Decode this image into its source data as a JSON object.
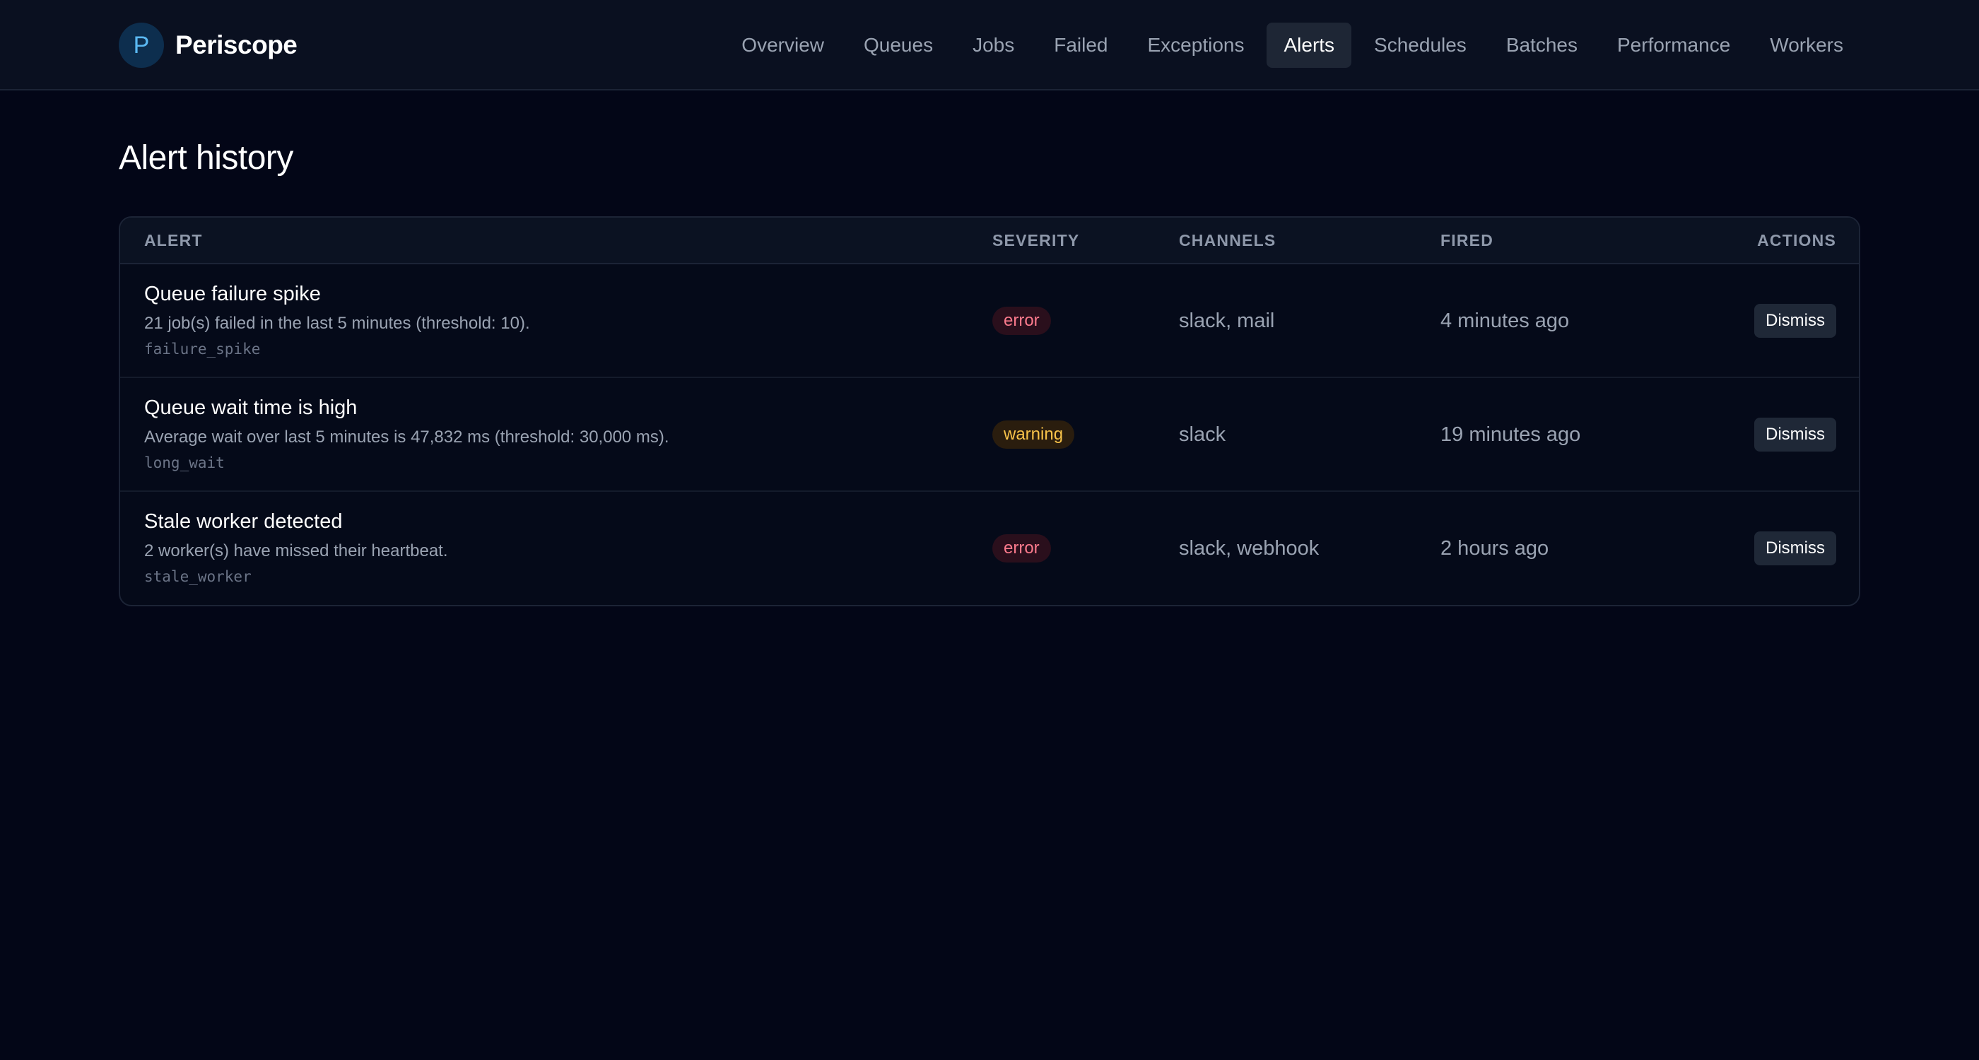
{
  "app": {
    "logo_letter": "P",
    "name": "Periscope"
  },
  "nav": {
    "items": [
      {
        "label": "Overview"
      },
      {
        "label": "Queues"
      },
      {
        "label": "Jobs"
      },
      {
        "label": "Failed"
      },
      {
        "label": "Exceptions"
      },
      {
        "label": "Alerts",
        "active": true
      },
      {
        "label": "Schedules"
      },
      {
        "label": "Batches"
      },
      {
        "label": "Performance"
      },
      {
        "label": "Workers"
      }
    ]
  },
  "page": {
    "title": "Alert history"
  },
  "table": {
    "headers": {
      "alert": "Alert",
      "severity": "Severity",
      "channels": "Channels",
      "fired": "Fired",
      "actions": "Actions"
    },
    "rows": [
      {
        "title": "Queue failure spike",
        "description": "21 job(s) failed in the last 5 minutes (threshold: 10).",
        "key": "failure_spike",
        "severity": "error",
        "channels": "slack, mail",
        "fired": "4 minutes ago",
        "action": "Dismiss"
      },
      {
        "title": "Queue wait time is high",
        "description": "Average wait over last 5 minutes is 47,832 ms (threshold: 30,000 ms).",
        "key": "long_wait",
        "severity": "warning",
        "channels": "slack",
        "fired": "19 minutes ago",
        "action": "Dismiss"
      },
      {
        "title": "Stale worker detected",
        "description": "2 worker(s) have missed their heartbeat.",
        "key": "stale_worker",
        "severity": "error",
        "channels": "slack, webhook",
        "fired": "2 hours ago",
        "action": "Dismiss"
      }
    ]
  },
  "colors": {
    "background": "#030617",
    "topbar": "#0a1020",
    "accent": "#5ab8f2",
    "error": "#fb7a8c",
    "warning": "#f8c34a"
  }
}
